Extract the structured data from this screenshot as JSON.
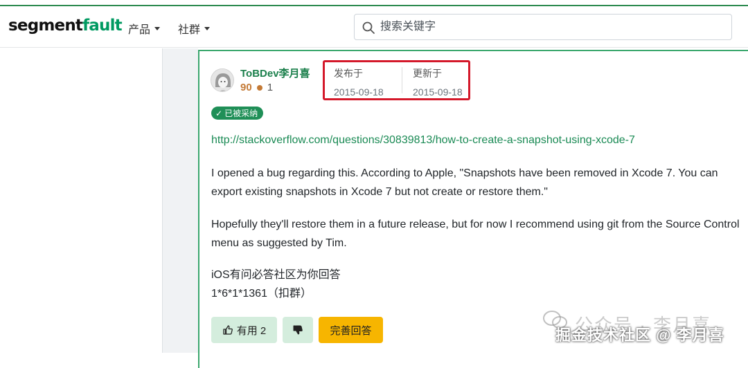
{
  "header": {
    "logo_part1": "segment",
    "logo_part2": "fault",
    "nav": [
      {
        "label": "产品"
      },
      {
        "label": "社群"
      }
    ],
    "search_placeholder": "搜索关键字"
  },
  "answer": {
    "author": "ToBDev李月喜",
    "reputation": "90",
    "badge_count": "1",
    "published_label": "发布于",
    "published_date": "2015-09-18",
    "updated_label": "更新于",
    "updated_date": "2015-09-18",
    "accepted_label": "已被采纳",
    "link": "http://stackoverflow.com/questions/30839813/how-to-create-a-snapshot-using-xcode-7",
    "para1": "I opened a bug regarding this. According to Apple, \"Snapshots have been removed in Xcode 7. You can export existing snapshots in Xcode 7 but not create or restore them.\"",
    "para2": "Hopefully they'll restore them in a future release, but for now I recommend using git from the Source Control menu as suggested by Tim.",
    "para3_line1": "iOS有问必答社区为你回答",
    "para3_line2": "1*6*1*1361（扣群）",
    "upvote_label": "有用 2",
    "answer_button": "完善回答"
  },
  "watermark": {
    "line1": "公众号 · 李月喜",
    "line2": "掘金技术社区 @ 李月喜"
  },
  "colors": {
    "brand_green": "#009a61",
    "highlight_red": "#d4182a",
    "accent_yellow": "#f7b500"
  }
}
